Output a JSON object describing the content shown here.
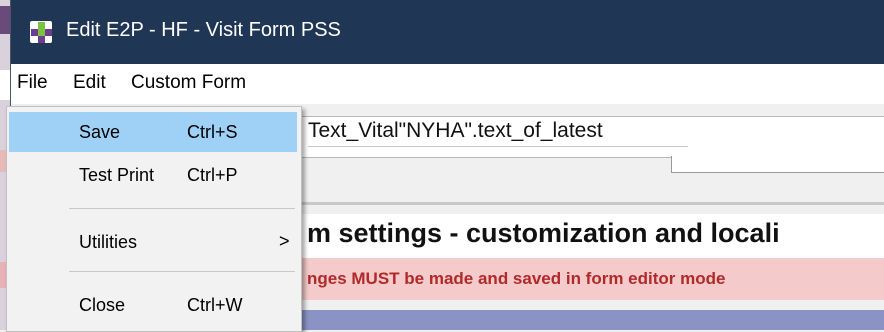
{
  "window": {
    "title": "Edit E2P - HF - Visit Form PSS"
  },
  "menubar": {
    "items": [
      {
        "label": "File"
      },
      {
        "label": "Edit"
      },
      {
        "label": "Custom Form"
      }
    ]
  },
  "file_menu": {
    "items": [
      {
        "label": "Save",
        "shortcut": "Ctrl+S",
        "highlighted": true
      },
      {
        "label": "Test Print",
        "shortcut": "Ctrl+P"
      },
      {
        "label": "Utilities",
        "submenu_arrow": ">"
      },
      {
        "label": "Close",
        "shortcut": "Ctrl+W"
      }
    ]
  },
  "form": {
    "field_text": "Text_Vital\"NYHA\".text_of_latest",
    "heading": "m settings - customization and locali",
    "warning": "nges MUST be made and saved in form editor mode"
  },
  "colors": {
    "titlebar": "#1f3654",
    "menu_highlight": "#9fd1f7",
    "warning_band": "#f4caca",
    "warning_text": "#b02a2a",
    "blue_band": "#8a93c4"
  },
  "icons": {
    "app": "app-logo-icon",
    "submenu": "chevron-right-icon"
  }
}
